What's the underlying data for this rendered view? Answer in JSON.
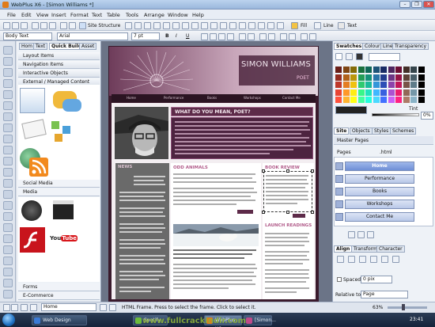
{
  "window": {
    "title": "WebPlus X6 - [Simon Williams *]",
    "controls": [
      "–",
      "❐",
      "✕"
    ]
  },
  "menubar": [
    "File",
    "Edit",
    "View",
    "Insert",
    "Format",
    "Text",
    "Table",
    "Tools",
    "Arrange",
    "Window",
    "Help"
  ],
  "toolbar": {
    "site_structure": "Site Structure",
    "fill": "Fill",
    "line": "Line",
    "text": "Text"
  },
  "format_bar": {
    "style": "Body Text",
    "font": "Arial",
    "size": "7 pt",
    "bold": "B",
    "italic": "I",
    "underline": "U"
  },
  "left_panel": {
    "tabs": [
      "Hom",
      "Text",
      "Quick Build",
      "Asset"
    ],
    "categories": [
      "Layout Items",
      "Navigation Items",
      "Interactive Objects",
      "External / Managed Content"
    ],
    "sections": [
      "Social Media",
      "Media",
      "Forms",
      "E-Commerce"
    ],
    "youtube_label": "YouTube"
  },
  "page": {
    "site_name": "SIMON WILLIAMS",
    "tagline": "POET",
    "nav": [
      "Home",
      "Performance",
      "Books",
      "Workshops",
      "Contact Me"
    ],
    "intro_title": "WHAT DO YOU MEAN, POET?",
    "news_title": "NEWS",
    "odd_title": "ODD ANIMALS",
    "book_title": "BOOK REVIEW",
    "launch_title": "LAUNCH READINGS",
    "read_more": "READ"
  },
  "right_panel": {
    "swatch_tabs": [
      "Swatches",
      "Colour",
      "Line",
      "Transparency"
    ],
    "tint_label": "Tint",
    "tint_value": "0%",
    "site_tabs": [
      "Site",
      "Objects",
      "Styles",
      "Schemes"
    ],
    "master_pages": "Master Pages",
    "pages_label": "Pages",
    "pages_file": ".html",
    "pages": [
      "Home",
      "Performance",
      "Books",
      "Workshops",
      "Contact Me"
    ],
    "align_tabs": [
      "Align",
      "Transform",
      "Character"
    ],
    "spaced": "Spaced",
    "spaced_value": "0 pix",
    "relative_to": "Relative to:",
    "relative_value": "Page"
  },
  "statusbar": {
    "page": "Home",
    "info": "HTML Frame. Press to select the frame. Click to select it.",
    "zoom": "63%"
  },
  "taskbar": {
    "items": [
      "Web Design survey",
      "Spotify",
      "WebPlus X6",
      "[Simon..."
    ],
    "clock": "23:41"
  },
  "watermark": "www.fullcrackindir.com",
  "colors": {
    "accent": "#5d2b49",
    "header_pink": "#c8a6ba",
    "title_link": "#b25d8b"
  }
}
